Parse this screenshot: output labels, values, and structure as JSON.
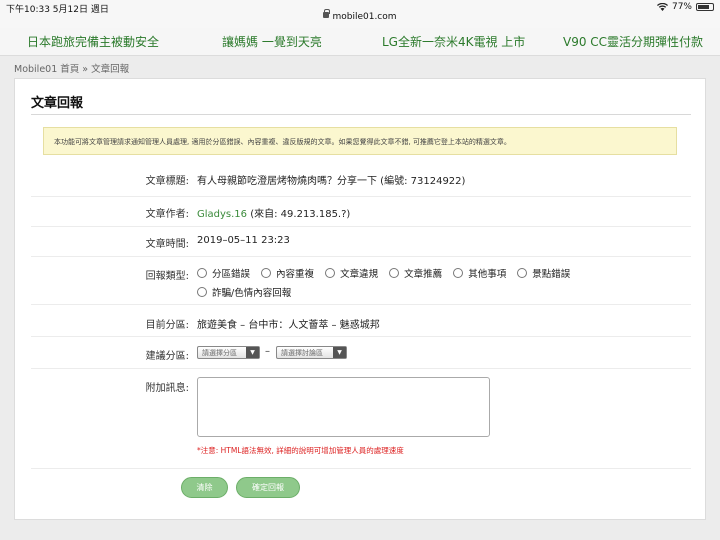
{
  "status": {
    "time": "下午10:33  5月12日 週日",
    "url": "mobile01.com",
    "battery": "77%",
    "battery_level": 0.77
  },
  "promo_links": [
    "日本跑旅完備主被動安全",
    "讓媽媽 一覺到天亮",
    "LG全新一奈米4K電視 上市",
    "V90 CC靈活分期彈性付款"
  ],
  "breadcrumb": "Mobile01 首頁 » 文章回報",
  "page_title": "文章回報",
  "notice": "本功能可將文章管理請求通知管理人員處理, 適用於分區錯誤、內容重複、違反版規的文章。如果您覺得此文章不錯, 可推薦它登上本站的精選文章。",
  "fields": {
    "article_title": {
      "label": "文章標題:",
      "value": "有人母親節吃澄居烤物燒肉嗎？分享一下 (編號: 73124922)"
    },
    "author": {
      "label": "文章作者:",
      "name": "Gladys.16",
      "source": " (來自: 49.213.185.?)"
    },
    "time": {
      "label": "文章時間:",
      "value": "2019–05–11 23:23"
    },
    "report_type": {
      "label": "回報類型:",
      "options": [
        "分區錯誤",
        "內容重複",
        "文章違規",
        "文章推薦",
        "其他事項",
        "景點錯誤",
        "詐騙/色情內容回報"
      ]
    },
    "current_section": {
      "label": "目前分區:",
      "value": "旅遊美食 – 台中市：人文薈萃 – 魅惑城邦"
    },
    "suggested_section": {
      "label": "建議分區:",
      "select1": "請選擇分區",
      "dash": "–",
      "select2": "請選擇討論區"
    },
    "message": {
      "label": "附加訊息:",
      "warning": "*注意: HTML語法無效, 詳細的說明可增加管理人員的處理速度"
    }
  },
  "buttons": {
    "clear": "清除",
    "submit": "確定回報"
  },
  "colors": {
    "accent_green": "#3a8a3a",
    "button_green": "#8fc98b",
    "notice_bg": "#fbf7cf",
    "warning_red": "#dd2222"
  }
}
